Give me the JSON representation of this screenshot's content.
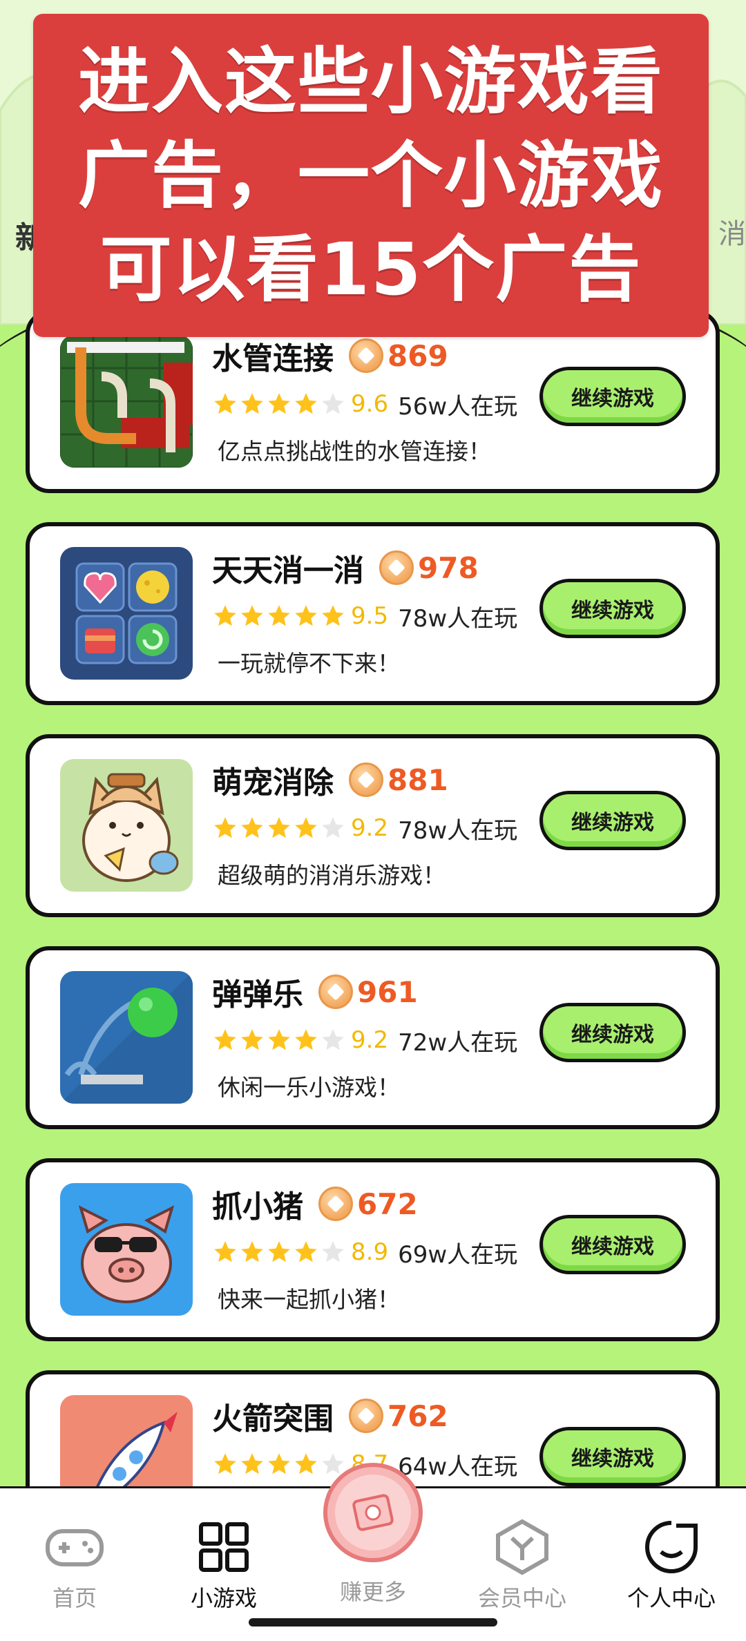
{
  "banner": {
    "line1": "进入这些小游戏看",
    "line2": "广告，一个小游戏",
    "line3": "可以看15个广告"
  },
  "header": {
    "left_partial": "新",
    "right_partial": "消"
  },
  "games": [
    {
      "title": "水管连接",
      "coins": "869",
      "stars": 4,
      "score": "9.6",
      "players": "56w人在玩",
      "desc": "亿点点挑战性的水管连接！",
      "button": "继续游戏",
      "icon": "pipe-puzzle-icon"
    },
    {
      "title": "天天消一消",
      "coins": "978",
      "stars": 5,
      "score": "9.5",
      "players": "78w人在玩",
      "desc": "一玩就停不下来！",
      "button": "继续游戏",
      "icon": "candy-match-icon"
    },
    {
      "title": "萌宠消除",
      "coins": "881",
      "stars": 4,
      "score": "9.2",
      "players": "78w人在玩",
      "desc": "超级萌的消消乐游戏！",
      "button": "继续游戏",
      "icon": "cute-cat-icon"
    },
    {
      "title": "弹弹乐",
      "coins": "961",
      "stars": 4,
      "score": "9.2",
      "players": "72w人在玩",
      "desc": "休闲一乐小游戏！",
      "button": "继续游戏",
      "icon": "bounce-ball-icon"
    },
    {
      "title": "抓小猪",
      "coins": "672",
      "stars": 4,
      "score": "8.9",
      "players": "69w人在玩",
      "desc": "快来一起抓小猪！",
      "button": "继续游戏",
      "icon": "pig-icon"
    },
    {
      "title": "火箭突围",
      "coins": "762",
      "stars": 4,
      "score": "8.7",
      "players": "64w人在玩",
      "desc": "",
      "button": "继续游戏",
      "icon": "rocket-icon"
    }
  ],
  "nav": {
    "home": "首页",
    "mini_games": "小游戏",
    "earn_more": "赚更多",
    "member_center": "会员中心",
    "personal_center": "个人中心"
  },
  "colors": {
    "background": "#b6f37a",
    "banner": "#db3f3d",
    "coin_text": "#ee5a24",
    "score": "#f2b800",
    "button": "#a8ef6e"
  }
}
